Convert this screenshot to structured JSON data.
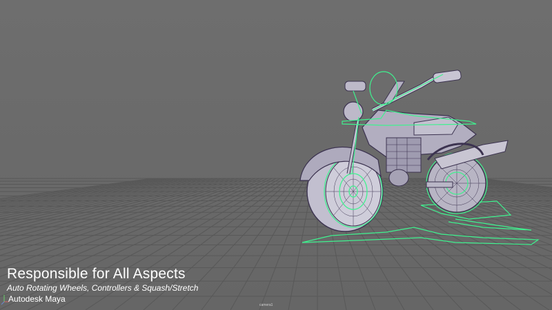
{
  "overlay": {
    "title": "Responsible for All Aspects",
    "subtitle": "Auto Rotating Wheels, Controllers & Squash/Stretch",
    "software": "Autodesk Maya"
  },
  "viewport": {
    "camera_label": "camera1"
  },
  "colors": {
    "background": "#6b6b6b",
    "grid": "#5a5a5a",
    "wireframe": "#3c3350",
    "mesh_fill": "#b9b6c6",
    "controller": "#3ff28f",
    "text": "#ffffff"
  }
}
